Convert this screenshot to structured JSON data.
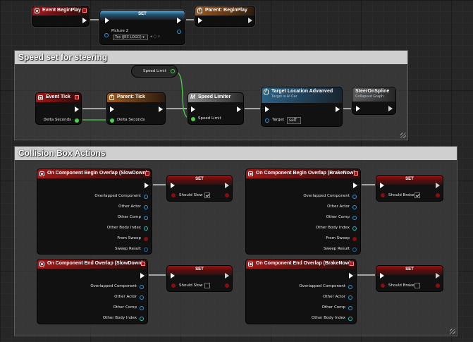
{
  "nodes": {
    "begin_play": {
      "title": "Event BeginPlay"
    },
    "set_picture": {
      "title": "SET",
      "pin_label": "Picture 2",
      "field_value": "Tex (JEX LOGO) ▾"
    },
    "parent_begin_play": {
      "title": "Parent: BeginPlay"
    },
    "speed_limit_getter": {
      "label": "Speed Limit"
    },
    "event_tick": {
      "title": "Event Tick",
      "pin_label": "Delta Seconds"
    },
    "parent_tick": {
      "title": "Parent: Tick",
      "pin_label": "Delta Seconds"
    },
    "speed_limiter": {
      "title": "Speed Limiter",
      "pin_label": "Speed Limit"
    },
    "target_location": {
      "title": "Target Location Advanved",
      "subtitle": "Target is AI Car",
      "target_label": "Target",
      "target_value": "self"
    },
    "steer_on_spline": {
      "title": "SteerOnSpline",
      "subtitle": "Collapsed Graph"
    },
    "begin_overlap_slow": {
      "title": "On Component Begin Overlap (SlowDown)",
      "pins": [
        "Overlapped Component",
        "Other Actor",
        "Other Comp",
        "Other Body Index",
        "From Sweep",
        "Sweep Result"
      ]
    },
    "set_should_slow_1": {
      "title": "SET",
      "pin_label": "Should Slow",
      "checked": true
    },
    "begin_overlap_brake": {
      "title": "On Component Begin Overlap (BrakeNow)",
      "pins": [
        "Overlapped Component",
        "Other Actor",
        "Other Comp",
        "Other Body Index",
        "From Sweep",
        "Sweep Result"
      ]
    },
    "set_should_brake_1": {
      "title": "SET",
      "pin_label": "Should Brake",
      "checked": true
    },
    "end_overlap_slow": {
      "title": "On Component End Overlap (SlowDown)",
      "pins": [
        "Overlapped Component",
        "Other Actor",
        "Other Comp",
        "Other Body Index"
      ]
    },
    "set_should_slow_2": {
      "title": "SET",
      "pin_label": "Should Slow",
      "checked": false
    },
    "end_overlap_brake": {
      "title": "On Component End Overlap (BrakeNow)",
      "pins": [
        "Overlapped Component",
        "Other Actor",
        "Other Comp",
        "Other Body Index"
      ]
    },
    "set_should_brake_2": {
      "title": "SET",
      "pin_label": "Should Brake",
      "checked": false
    }
  },
  "comments": {
    "steering": {
      "title": "Speed set for steering"
    },
    "collision": {
      "title": "Collision Box Actions"
    }
  },
  "colors": {
    "exec_wire": "#ffffff",
    "float_wire": "#49d14b",
    "object_pin": "#2e9bd6",
    "bool_pin": "#8b0d0d"
  }
}
